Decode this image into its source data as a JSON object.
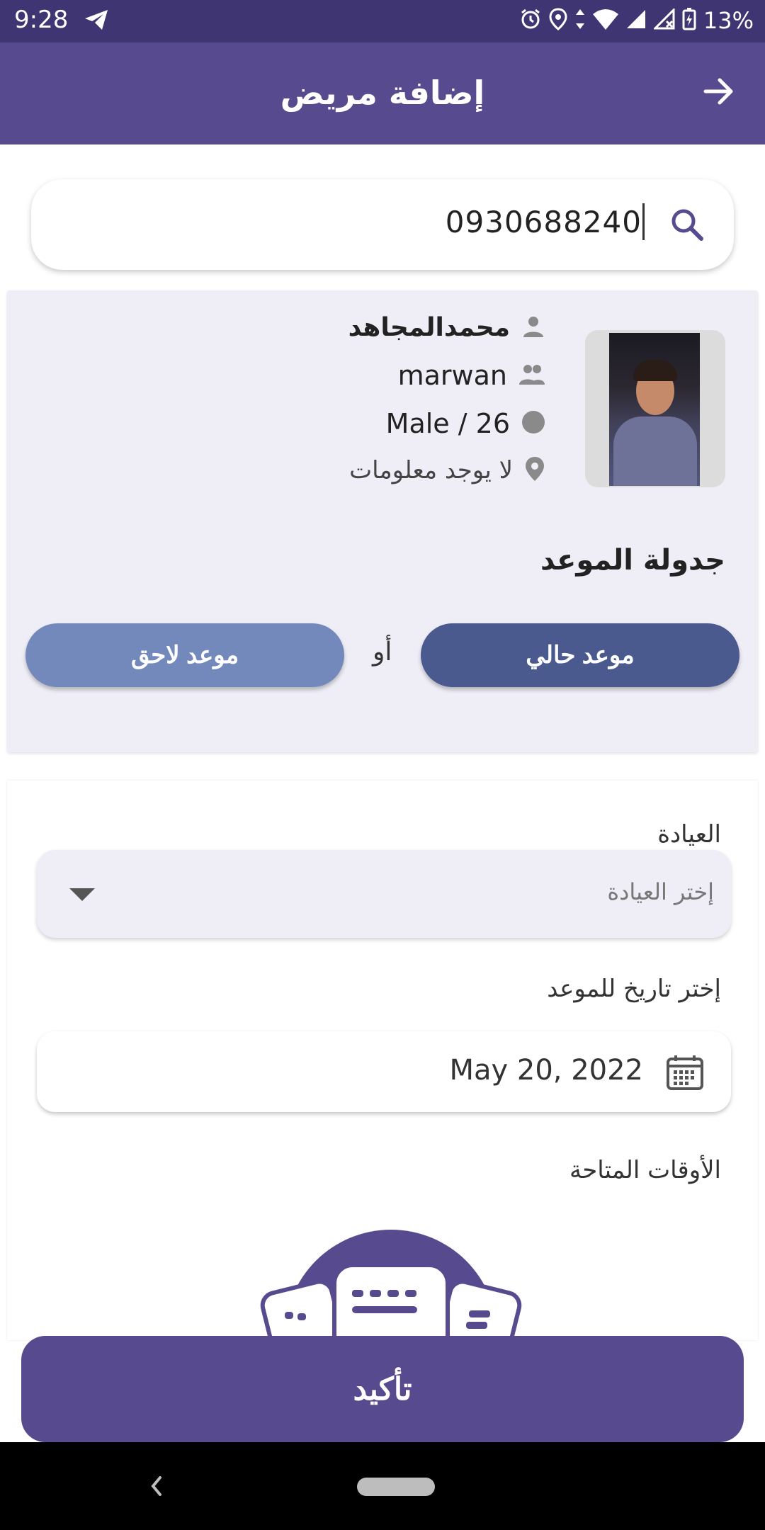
{
  "status_bar": {
    "time": "9:28",
    "battery": "13%"
  },
  "header": {
    "title": "إضافة مريض"
  },
  "search": {
    "value": "0930688240"
  },
  "patient": {
    "name": "محمدالمجاهد",
    "username": "marwan",
    "gender_age": "Male / 26",
    "location": "لا يوجد معلومات"
  },
  "schedule": {
    "title": "جدولة الموعد",
    "now_label": "موعد حالي",
    "or_label": "أو",
    "later_label": "موعد لاحق"
  },
  "form": {
    "clinic_label": "العيادة",
    "clinic_placeholder": "إختر العيادة",
    "date_label": "إختر تاريخ للموعد",
    "date_value": "May 20, 2022",
    "times_label": "الأوقات المتاحة"
  },
  "confirm": {
    "label": "تأكيد"
  },
  "colors": {
    "primary": "#574a8e",
    "status_bar": "#3f3573",
    "card_bg": "#efeef7",
    "btn_now": "#4a5a8f",
    "btn_later": "#7388bb"
  }
}
